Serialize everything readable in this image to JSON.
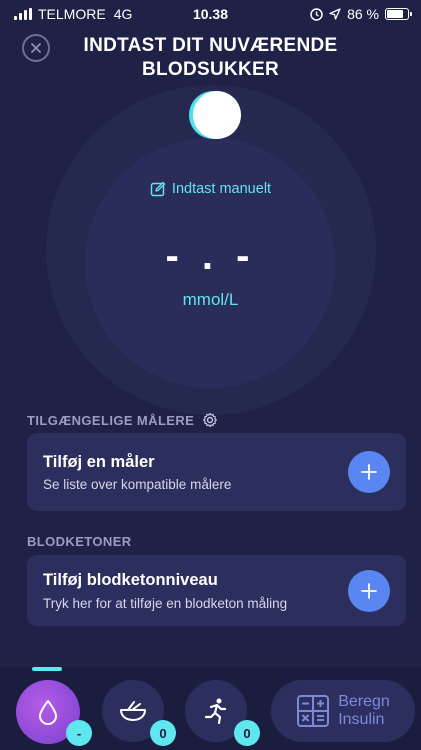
{
  "status_bar": {
    "carrier": "TELMORE",
    "network": "4G",
    "time": "10.38",
    "battery": "86 %"
  },
  "header": {
    "title": "INDTAST DIT NUVÆRENDE BLODSUKKER",
    "close_icon": "close-circle-icon"
  },
  "dial": {
    "manual_entry_label": "Indtast manuelt",
    "value": "- . -",
    "unit": "mmol/L"
  },
  "meters": {
    "section_label": "TILGÆNGELIGE MÅLERE",
    "card_title": "Tilføj en måler",
    "card_subtitle": "Se liste over kompatible målere"
  },
  "ketones": {
    "section_label": "BLODKETONER",
    "card_title": "Tilføj blodketonniveau",
    "card_subtitle": "Tryk her for at tilføje en blodketon måling"
  },
  "bottom_nav": {
    "blood_badge": "-",
    "food_badge": "0",
    "activity_badge": "0",
    "calc_label_line1": "Beregn",
    "calc_label_line2": "Insulin"
  },
  "colors": {
    "background": "#1f2147",
    "accent_cyan": "#5fe6ee",
    "button_blue": "#5a86f2",
    "drop_purple": "#9a4fdc"
  }
}
